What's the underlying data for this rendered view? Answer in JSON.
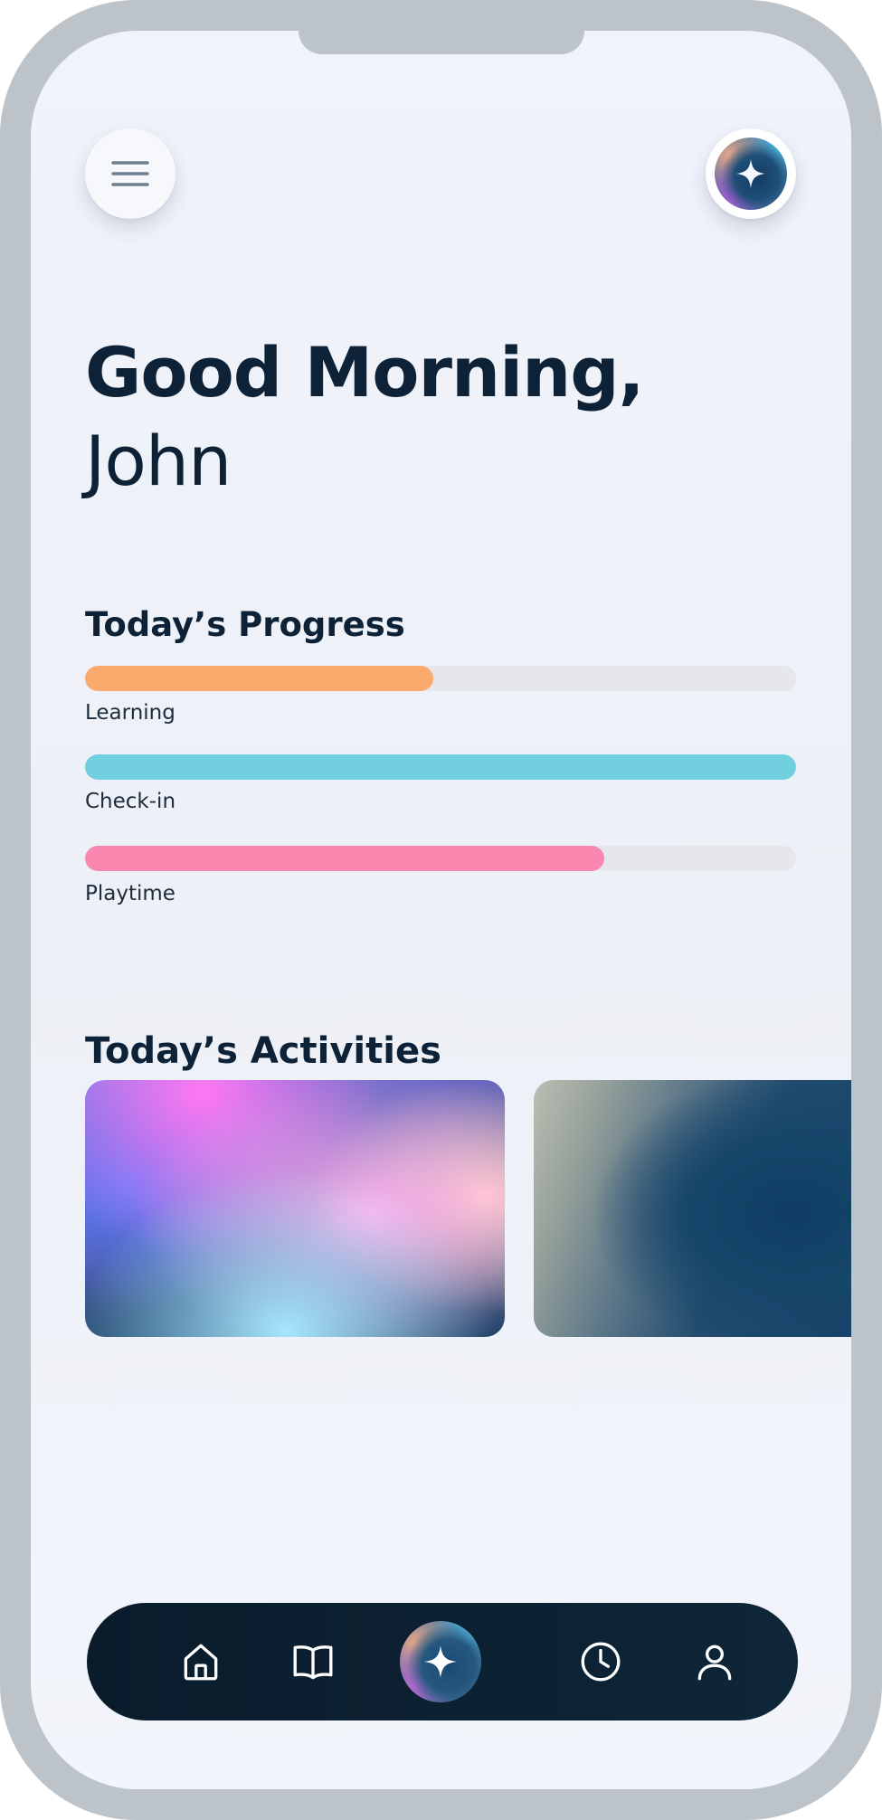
{
  "greeting": {
    "line1": "Good Morning,",
    "name": "John"
  },
  "header": {
    "menu_icon": "menu-icon",
    "assistant_icon": "sparkle-icon"
  },
  "progress": {
    "title": "Today’s Progress",
    "items": [
      {
        "label": "Learning",
        "percent": 49,
        "color": "#fbaa6e"
      },
      {
        "label": "Check-in",
        "percent": 100,
        "color": "#72cfe0"
      },
      {
        "label": "Playtime",
        "percent": 73,
        "color": "#f987b0"
      }
    ]
  },
  "activities": {
    "title": "Today’s Activities"
  },
  "nav": {
    "items": [
      {
        "id": "home",
        "icon": "home-icon"
      },
      {
        "id": "learn",
        "icon": "book-icon"
      },
      {
        "id": "assistant",
        "icon": "sparkle-icon"
      },
      {
        "id": "history",
        "icon": "clock-icon"
      },
      {
        "id": "profile",
        "icon": "user-icon"
      }
    ]
  },
  "colors": {
    "text_primary": "#0d2236",
    "track": "#e5e7ed",
    "nav_background": "#0b1f2f",
    "frame": "#bcc3c9"
  }
}
